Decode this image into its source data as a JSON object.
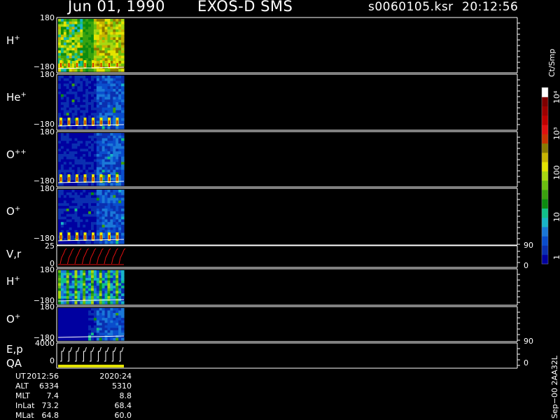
{
  "header": {
    "date": "Jun 01, 1990",
    "instrument": "EXOS-D SMS",
    "file": "s0060105.ksr",
    "time": "20:12:56"
  },
  "panels": [
    {
      "id": "h-plus-1",
      "label": "H",
      "sup": "+",
      "tick_top": "180",
      "tick_bottom": "−180",
      "scheme": "high"
    },
    {
      "id": "he-plus",
      "label": "He",
      "sup": "+",
      "tick_top": "180",
      "tick_bottom": "−180",
      "scheme": "low"
    },
    {
      "id": "o-plusplus",
      "label": "O",
      "sup": "++",
      "tick_top": "180",
      "tick_bottom": "−180",
      "scheme": "low"
    },
    {
      "id": "o-plus-1",
      "label": "O",
      "sup": "+",
      "tick_top": "180",
      "tick_bottom": "−180",
      "scheme": "low"
    },
    {
      "id": "vr",
      "label": "V,r",
      "sup": "",
      "tick_top": "25",
      "tick_bottom": "0",
      "right_top": "90",
      "right_bottom": "0",
      "scheme": "line-red"
    },
    {
      "id": "h-plus-2",
      "label": "H",
      "sup": "+",
      "tick_top": "180",
      "tick_bottom": "−180",
      "scheme": "bars"
    },
    {
      "id": "o-plus-2",
      "label": "O",
      "sup": "+",
      "tick_top": "180",
      "tick_bottom": "−180",
      "scheme": "low2"
    },
    {
      "id": "ep-qa",
      "label": "E,p",
      "label2": "QA",
      "sup": "",
      "tick_top": "4000",
      "tick_bottom": "0",
      "right_top": "90",
      "right_bottom": "0",
      "scheme": "line-white"
    }
  ],
  "colorbar": {
    "unit": "Ct/Smp",
    "labels": [
      "1",
      "10",
      "100",
      "10³",
      "10⁴"
    ],
    "colors": [
      "#0000a0",
      "#0a2fb0",
      "#0a4dcc",
      "#1a78d8",
      "#18b4c8",
      "#10c08a",
      "#0c8c10",
      "#3aa20e",
      "#6cc010",
      "#a8d810",
      "#e4e400",
      "#c8b400",
      "#8a7a00",
      "#c83200",
      "#e01010",
      "#c00000",
      "#a00000",
      "#800000",
      "#ffffff"
    ]
  },
  "chart_data": {
    "type": "heatmap",
    "title": "Jun 01, 1990   EXOS-D SMS",
    "panels": [
      "H+",
      "He+",
      "O++",
      "O+",
      "V,r",
      "H+",
      "O+",
      "E,p QA"
    ],
    "colorbar_unit": "Ct/Smp",
    "colorbar_scale": "log",
    "colorbar_range": [
      1,
      10000
    ]
  },
  "footer": {
    "rows": [
      {
        "name": "UT",
        "v1": "2012:56",
        "v2": "2020:24"
      },
      {
        "name": "ALT",
        "v1": "6334",
        "v2": "5310"
      },
      {
        "name": "MLT",
        "v1": "7.4",
        "v2": "8.8"
      },
      {
        "name": "InLat",
        "v1": "73.2",
        "v2": "68.4"
      },
      {
        "name": "MLat",
        "v1": "64.8",
        "v2": "60.0"
      }
    ],
    "code": "Sep−00 2AA32L"
  }
}
